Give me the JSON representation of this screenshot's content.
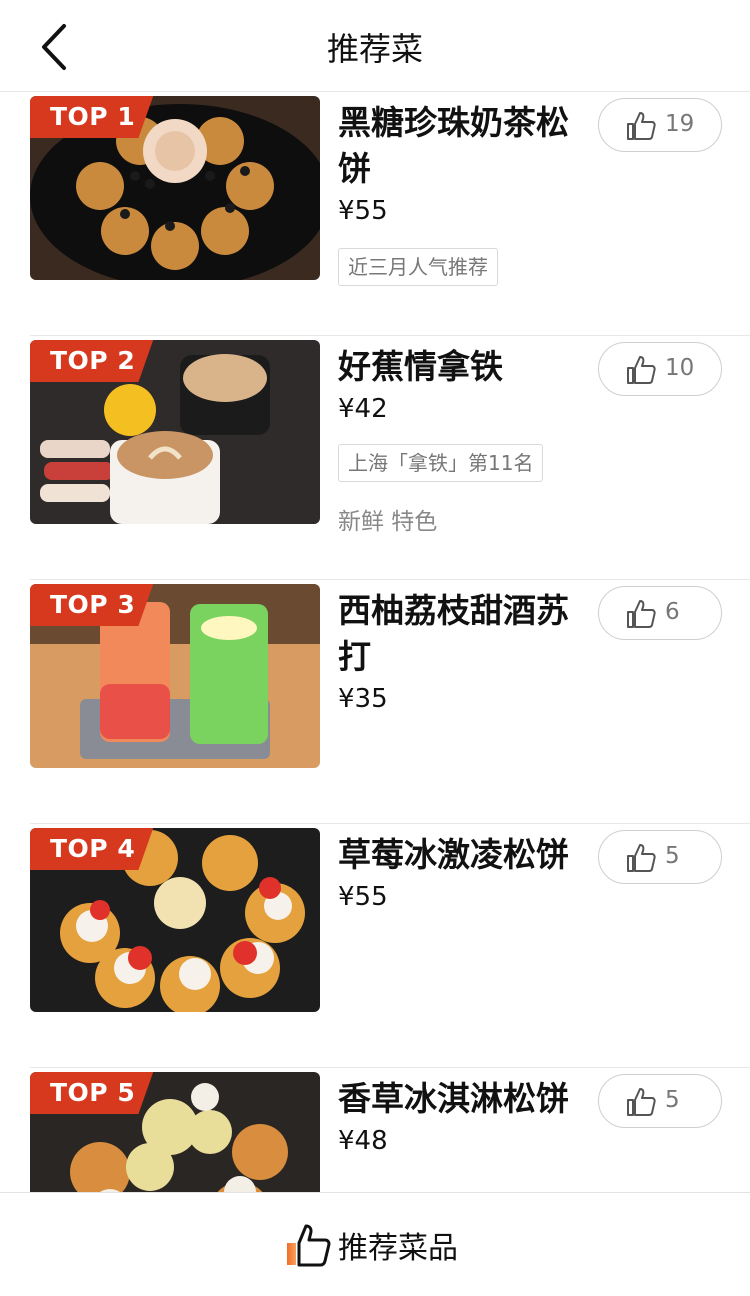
{
  "header": {
    "title": "推荐菜"
  },
  "items": [
    {
      "rank": "TOP 1",
      "name": "黑糖珍珠奶茶松饼",
      "price": "¥55",
      "tag": "近三月人气推荐",
      "features": "",
      "likes": "19"
    },
    {
      "rank": "TOP 2",
      "name": "好蕉情拿铁",
      "price": "¥42",
      "tag": "上海「拿铁」第11名",
      "features": "新鲜  特色",
      "likes": "10"
    },
    {
      "rank": "TOP 3",
      "name": "西柚荔枝甜酒苏打",
      "price": "¥35",
      "tag": "",
      "features": "",
      "likes": "6"
    },
    {
      "rank": "TOP 4",
      "name": "草莓冰激凌松饼",
      "price": "¥55",
      "tag": "",
      "features": "",
      "likes": "5"
    },
    {
      "rank": "TOP 5",
      "name": "香草冰淇淋松饼",
      "price": "¥48",
      "tag": "",
      "features": "",
      "likes": "5"
    }
  ],
  "bottom_bar": {
    "label": "推荐菜品"
  },
  "colors": {
    "rank_badge": "#d7391f",
    "accent_gradient": "#f36b2b"
  }
}
